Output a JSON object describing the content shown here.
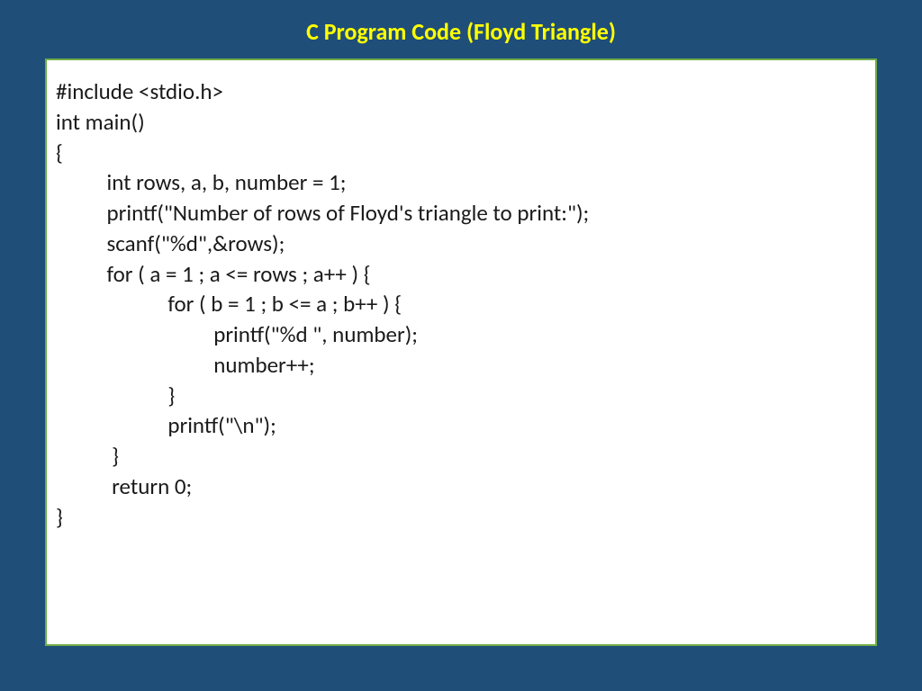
{
  "title": "C Program Code (Floyd Triangle)",
  "code": "#include <stdio.h>\nint main()\n{\n          int rows, a, b, number = 1;\n          printf(\"Number of rows of Floyd's triangle to print:\");\n          scanf(\"%d\",&rows);\n          for ( a = 1 ; a <= rows ; a++ ) {\n                      for ( b = 1 ; b <= a ; b++ ) {\n                               printf(\"%d \", number);\n                               number++;\n                      }\n                      printf(\"\\n\");\n           }\n           return 0;\n}"
}
